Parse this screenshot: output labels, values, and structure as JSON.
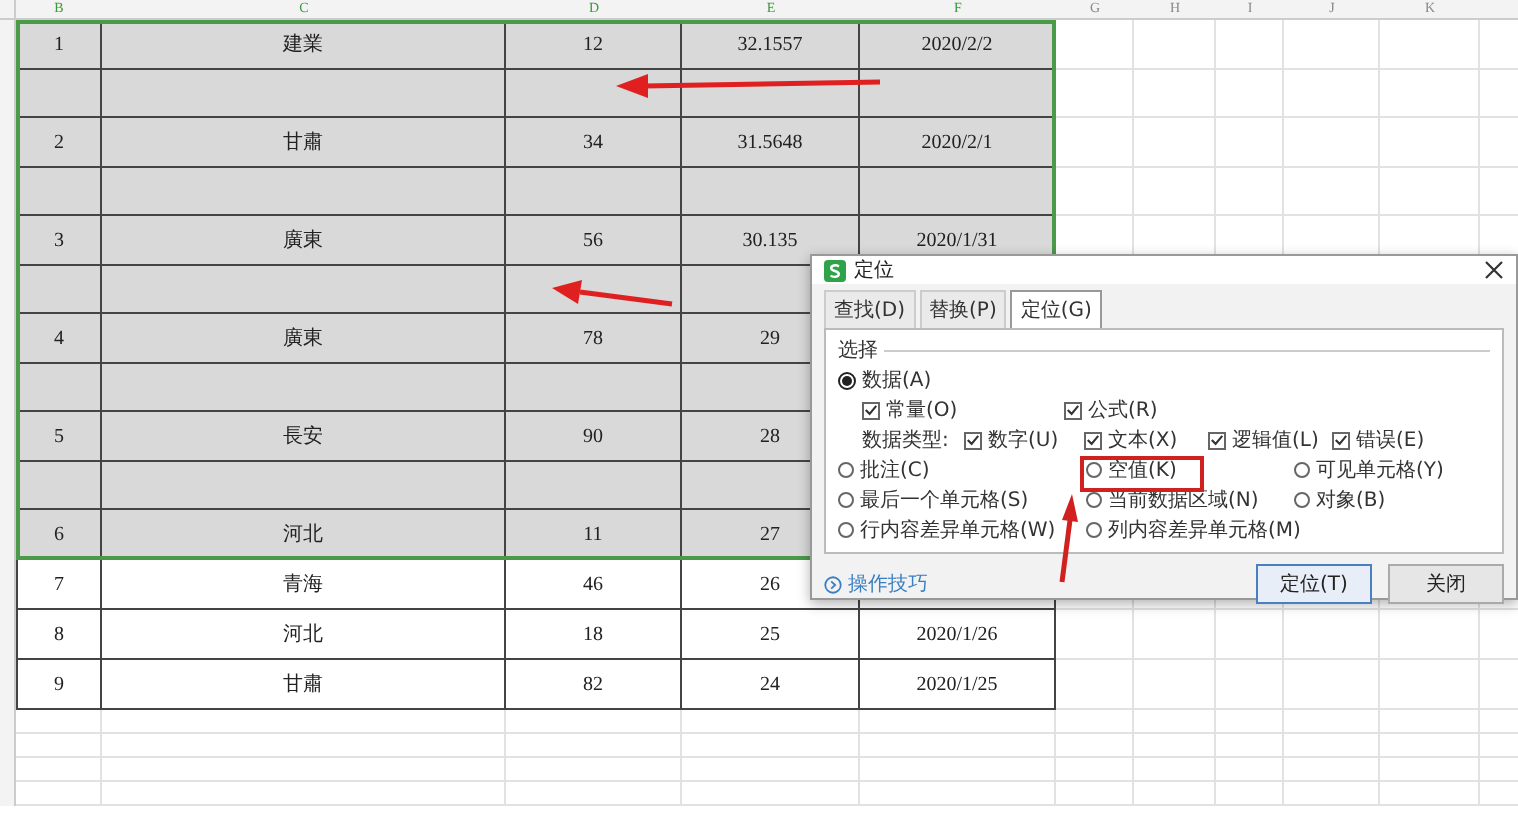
{
  "columns": [
    {
      "label": "B",
      "selected": true
    },
    {
      "label": "C",
      "selected": true
    },
    {
      "label": "D",
      "selected": true
    },
    {
      "label": "E",
      "selected": true
    },
    {
      "label": "F",
      "selected": true
    },
    {
      "label": "G",
      "selected": false
    },
    {
      "label": "H",
      "selected": false
    },
    {
      "label": "I",
      "selected": false
    },
    {
      "label": "J",
      "selected": false
    },
    {
      "label": "K",
      "selected": false
    }
  ],
  "rows": [
    {
      "kind": "data",
      "selected": true,
      "cells": [
        "1",
        "建業",
        "12",
        "32.1557",
        "2020/2/2"
      ]
    },
    {
      "kind": "blank",
      "selected": true
    },
    {
      "kind": "data",
      "selected": true,
      "cells": [
        "2",
        "甘肅",
        "34",
        "31.5648",
        "2020/2/1"
      ]
    },
    {
      "kind": "blank",
      "selected": true
    },
    {
      "kind": "data",
      "selected": true,
      "cells": [
        "3",
        "廣東",
        "56",
        "30.135",
        "2020/1/31"
      ]
    },
    {
      "kind": "blank",
      "selected": true
    },
    {
      "kind": "data",
      "selected": true,
      "cells": [
        "4",
        "廣東",
        "78",
        "29"
      ]
    },
    {
      "kind": "blank",
      "selected": true
    },
    {
      "kind": "data",
      "selected": true,
      "cells": [
        "5",
        "長安",
        "90",
        "28"
      ]
    },
    {
      "kind": "blank",
      "selected": true
    },
    {
      "kind": "data",
      "selected": true,
      "cells": [
        "6",
        "河北",
        "11",
        "27"
      ]
    },
    {
      "kind": "data",
      "selected": false,
      "cells": [
        "7",
        "青海",
        "46",
        "26"
      ]
    },
    {
      "kind": "data",
      "selected": false,
      "cells": [
        "8",
        "河北",
        "18",
        "25",
        "2020/1/26"
      ]
    },
    {
      "kind": "data",
      "selected": false,
      "cells": [
        "9",
        "甘肅",
        "82",
        "24",
        "2020/1/25"
      ]
    }
  ],
  "dialog": {
    "title": "定位",
    "tabs": [
      {
        "label": "查找(D)",
        "selected": false
      },
      {
        "label": "替换(P)",
        "selected": false
      },
      {
        "label": "定位(G)",
        "selected": true
      }
    ],
    "group_label": "选择",
    "data_option": {
      "label": "数据(A)",
      "selected": true
    },
    "subtypes": [
      {
        "label": "常量(O)",
        "checked": true
      },
      {
        "label": "公式(R)",
        "checked": true
      }
    ],
    "data_type_label": "数据类型:",
    "data_types": [
      {
        "label": "数字(U)",
        "checked": true
      },
      {
        "label": "文本(X)",
        "checked": true
      },
      {
        "label": "逻辑值(L)",
        "checked": true
      },
      {
        "label": "错误(E)",
        "checked": true
      }
    ],
    "radio_rows": [
      {
        "options": [
          {
            "label": "批注(C)",
            "selected": false
          },
          {
            "label": "空值(K)",
            "selected": false
          },
          {
            "label": "可见单元格(Y)",
            "selected": false
          }
        ]
      },
      {
        "options": [
          {
            "label": "最后一个单元格(S)",
            "selected": false
          },
          {
            "label": "当前数据区域(N)",
            "selected": false
          },
          {
            "label": "对象(B)",
            "selected": false
          }
        ]
      },
      {
        "options": [
          {
            "label": "行内容差异单元格(W)",
            "selected": false
          },
          {
            "label": "列内容差异单元格(M)",
            "selected": false
          }
        ]
      }
    ],
    "tips_link": "操作技巧",
    "buttons": [
      {
        "label": "定位(T)",
        "kind": "primary"
      },
      {
        "label": "关闭",
        "kind": "normal"
      }
    ]
  }
}
